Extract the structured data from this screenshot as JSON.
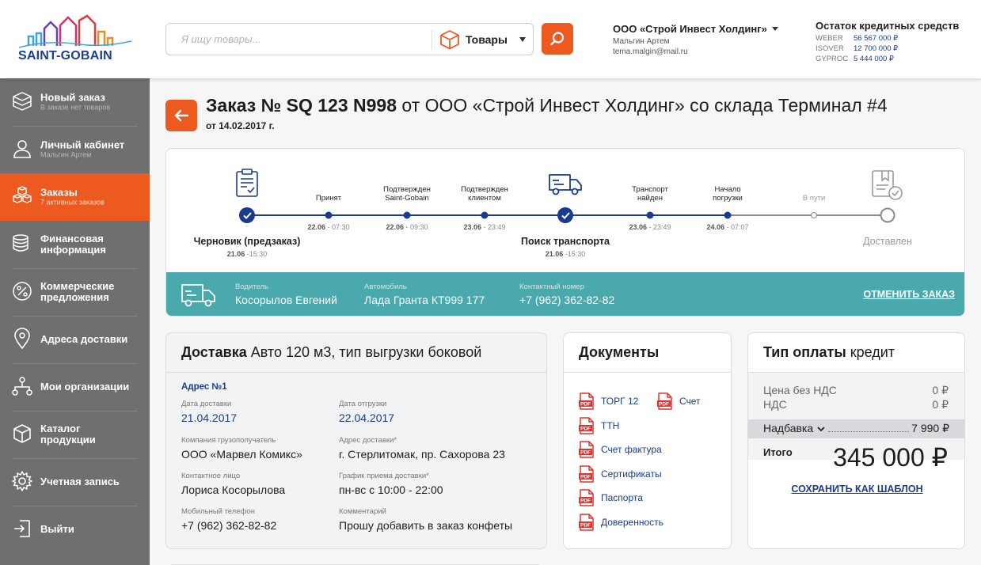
{
  "header": {
    "logo_text": "SAINT-GOBAIN",
    "search_placeholder": "Я ищу товары...",
    "category_label": "Товары",
    "org_name": "ООО «Строй Инвест Холдинг»",
    "user_name": "Мальгин Артем",
    "user_email": "tema.malgin@mail.ru",
    "credit_title": "Остаток кредитных средств",
    "credits": [
      {
        "brand": "WEBER",
        "amount": "56 567 000 ₽"
      },
      {
        "brand": "ISOVER",
        "amount": "12 700 000 ₽"
      },
      {
        "brand": "GYPROC",
        "amount": "5 444 000 ₽"
      }
    ],
    "accent": "#ec5a20"
  },
  "sidebar": {
    "items": [
      {
        "label": "Новый заказ",
        "sub": "В заказе нет товаров",
        "icon": "box-icon"
      },
      {
        "label": "Личный кабинет",
        "sub": "Мальгин Артем",
        "icon": "user-icon"
      },
      {
        "label": "Заказы",
        "sub": "7 активных заказов",
        "icon": "boxes-icon"
      },
      {
        "label": "Финансовая\nинформация",
        "sub": "",
        "icon": "coins-icon"
      },
      {
        "label": "Коммерческие\nпредложения",
        "sub": "",
        "icon": "percent-icon"
      },
      {
        "label": "Адреса доставки",
        "sub": "",
        "icon": "location-pin-icon"
      },
      {
        "label": "Мои организации",
        "sub": "",
        "icon": "organization-icon"
      },
      {
        "label": "Каталог\nпродукции",
        "sub": "",
        "icon": "cube-icon"
      },
      {
        "label": "Учетная запись",
        "sub": "",
        "icon": "gear-icon"
      },
      {
        "label": "Выйти",
        "sub": "",
        "icon": "logout-icon"
      }
    ]
  },
  "order": {
    "title_bold": "Заказ № SQ 123 N998",
    "title_rest": "от ООО «Строй Инвест Холдинг»  со склада Терминал #4",
    "date": "от 14.02.2017 г."
  },
  "timeline": {
    "steps": [
      {
        "top": "",
        "big": "Черновик (предзаказ)",
        "day": "21.06",
        "time": "-15:30",
        "state": "done-big"
      },
      {
        "top": "Принят",
        "big": "",
        "day": "22.06",
        "time": "- 07:30",
        "state": "done"
      },
      {
        "top": "Подтвержден\nSaint-Gobain",
        "big": "",
        "day": "22.06",
        "time": "- 09:30",
        "state": "done"
      },
      {
        "top": "Подтвержден\nклиентом",
        "big": "",
        "day": "23.06",
        "time": "- 23:49",
        "state": "done"
      },
      {
        "top": "",
        "big": "Поиск транспорта",
        "day": "21.06",
        "time": "-15:30",
        "state": "done-big"
      },
      {
        "top": "Транспорт\nнайден",
        "big": "",
        "day": "23.06",
        "time": "- 23:49",
        "state": "done"
      },
      {
        "top": "Начало\nпогрузки",
        "big": "",
        "day": "24.06",
        "time": "- 07:07",
        "state": "done"
      },
      {
        "top": "В пути",
        "big": "",
        "day": "",
        "time": "",
        "state": "pending"
      },
      {
        "top": "",
        "big": "Доставлен",
        "day": "",
        "time": "",
        "state": "pending-big"
      }
    ]
  },
  "driver": {
    "driver_label": "Водитель",
    "driver_value": "Косорылов Евгений",
    "car_label": "Автомобиль",
    "car_value": "Лада Гранта  КТ999 177",
    "phone_label": "Контактный номер",
    "phone_value": "+7 (962) 362-82-82",
    "cancel_label": "ОТМЕНИТЬ ЗАКАЗ",
    "bg_color": "#4aa9ad"
  },
  "delivery": {
    "title_bold": "Доставка",
    "title_rest": "Авто 120 м3, тип выгрузки боковой",
    "address_title": "Адрес №1",
    "fields": {
      "delivery_date_label": "Дата доставки",
      "delivery_date": "21.04.2017",
      "ship_date_label": "Дата отгрузки",
      "ship_date": "22.04.2017",
      "consignee_label": "Компания грузополучатель",
      "consignee": "ООО «Марвел Комикс»",
      "address_label": "Адрес доставки*",
      "address": "г. Стерлитомак, пр. Сахорова 23",
      "contact_label": "Контактное лицо",
      "contact": "Лориса Косорылова",
      "schedule_label": "График приема доставки*",
      "schedule": "пн-вс с 10:00 - 22:00",
      "mobile_label": "Мобильный телефон",
      "mobile": "+7 (962) 362-82-82",
      "comment_label": "Комментарий",
      "comment": "Прошу добавить в заказ конфеты"
    }
  },
  "documents": {
    "title": "Документы",
    "items": [
      "ТОРГ 12",
      "Счет",
      "ТТН",
      "Счет фактура",
      "Сертификаты",
      "Паспорта",
      "Доверенность"
    ]
  },
  "payment": {
    "title_bold": "Тип оплаты",
    "title_rest": "кредит",
    "price_label": "Цена без НДС",
    "price_value": "0 ₽",
    "vat_label": "НДС",
    "vat_value": "0 ₽",
    "markup_label": "Надбавка",
    "markup_value": "7 990 ₽",
    "total_label": "Итого",
    "total_value": "345 000 ₽",
    "save_label": "СОХРАНИТЬ КАК ШАБЛОН"
  }
}
